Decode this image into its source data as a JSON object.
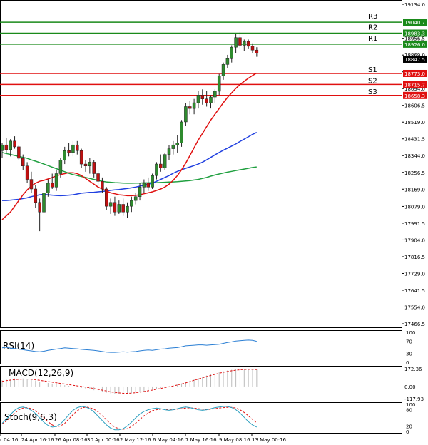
{
  "chart_data": {
    "type": "candlestick",
    "main": {
      "price_ticks": [
        "19134.0",
        "19046.5",
        "18956.5",
        "18869.0",
        "18781.5",
        "18694.0",
        "18606.5",
        "18519.0",
        "18431.5",
        "18344.0",
        "18256.5",
        "18169.0",
        "18079.0",
        "17991.5",
        "17904.0",
        "17816.5",
        "17729.0",
        "17641.5",
        "17554.0",
        "17466.5"
      ],
      "ylim": [
        17466.5,
        19134.0
      ],
      "current_price": "18847.5",
      "levels": [
        {
          "name": "R3",
          "value": 19040.7,
          "label": "19040.7",
          "color": "#1a8a1a"
        },
        {
          "name": "R2",
          "value": 18983.3,
          "label": "18983.3",
          "color": "#1a8a1a"
        },
        {
          "name": "R1",
          "value": 18926.0,
          "label": "18926.0",
          "color": "#1a8a1a"
        },
        {
          "name": "S1",
          "value": 18773.0,
          "label": "18773.0",
          "color": "#e01010"
        },
        {
          "name": "S2",
          "value": 18715.7,
          "label": "18715.7",
          "color": "#e01010"
        },
        {
          "name": "S3",
          "value": 18658.3,
          "label": "18658.3",
          "color": "#e01010"
        }
      ],
      "candles": [
        [
          18370,
          18410,
          18330,
          18400
        ],
        [
          18400,
          18435,
          18360,
          18375
        ],
        [
          18375,
          18430,
          18340,
          18420
        ],
        [
          18420,
          18445,
          18380,
          18390
        ],
        [
          18390,
          18400,
          18320,
          18330
        ],
        [
          18330,
          18350,
          18270,
          18290
        ],
        [
          18290,
          18310,
          18200,
          18220
        ],
        [
          18220,
          18260,
          18150,
          18170
        ],
        [
          18170,
          18190,
          18070,
          18100
        ],
        [
          18100,
          18120,
          17950,
          18050
        ],
        [
          18050,
          18170,
          18040,
          18150
        ],
        [
          18150,
          18220,
          18130,
          18200
        ],
        [
          18200,
          18250,
          18170,
          18180
        ],
        [
          18180,
          18270,
          18160,
          18250
        ],
        [
          18250,
          18330,
          18230,
          18320
        ],
        [
          18320,
          18390,
          18300,
          18370
        ],
        [
          18370,
          18410,
          18340,
          18360
        ],
        [
          18360,
          18420,
          18340,
          18400
        ],
        [
          18400,
          18420,
          18350,
          18370
        ],
        [
          18370,
          18380,
          18280,
          18300
        ],
        [
          18300,
          18320,
          18260,
          18290
        ],
        [
          18290,
          18330,
          18250,
          18310
        ],
        [
          18310,
          18320,
          18230,
          18250
        ],
        [
          18250,
          18270,
          18190,
          18210
        ],
        [
          18210,
          18230,
          18150,
          18170
        ],
        [
          18170,
          18180,
          18060,
          18080
        ],
        [
          18080,
          18120,
          18040,
          18100
        ],
        [
          18100,
          18130,
          18030,
          18050
        ],
        [
          18050,
          18110,
          18040,
          18090
        ],
        [
          18090,
          18120,
          18030,
          18050
        ],
        [
          18050,
          18100,
          18020,
          18080
        ],
        [
          18080,
          18130,
          18050,
          18110
        ],
        [
          18110,
          18150,
          18090,
          18130
        ],
        [
          18130,
          18200,
          18110,
          18180
        ],
        [
          18180,
          18220,
          18150,
          18200
        ],
        [
          18200,
          18230,
          18160,
          18180
        ],
        [
          18180,
          18250,
          18170,
          18240
        ],
        [
          18240,
          18310,
          18220,
          18300
        ],
        [
          18300,
          18350,
          18260,
          18280
        ],
        [
          18280,
          18360,
          18270,
          18350
        ],
        [
          18350,
          18400,
          18320,
          18380
        ],
        [
          18380,
          18420,
          18350,
          18400
        ],
        [
          18400,
          18450,
          18360,
          18410
        ],
        [
          18410,
          18530,
          18390,
          18520
        ],
        [
          18520,
          18620,
          18500,
          18600
        ],
        [
          18600,
          18630,
          18560,
          18590
        ],
        [
          18590,
          18640,
          18560,
          18620
        ],
        [
          18620,
          18680,
          18590,
          18660
        ],
        [
          18660,
          18690,
          18610,
          18640
        ],
        [
          18640,
          18680,
          18600,
          18620
        ],
        [
          18620,
          18660,
          18590,
          18650
        ],
        [
          18650,
          18690,
          18620,
          18680
        ],
        [
          18680,
          18770,
          18660,
          18760
        ],
        [
          18760,
          18830,
          18740,
          18820
        ],
        [
          18820,
          18870,
          18800,
          18850
        ],
        [
          18850,
          18920,
          18830,
          18910
        ],
        [
          18910,
          18980,
          18880,
          18960
        ],
        [
          18960,
          18990,
          18900,
          18920
        ],
        [
          18920,
          18950,
          18890,
          18940
        ],
        [
          18940,
          18950,
          18900,
          18915
        ],
        [
          18915,
          18930,
          18880,
          18895
        ],
        [
          18895,
          18910,
          18860,
          18880
        ]
      ],
      "ma_fast": [
        18010,
        18030,
        18050,
        18080,
        18110,
        18140,
        18165,
        18185,
        18200,
        18210,
        18215,
        18222,
        18230,
        18238,
        18245,
        18250,
        18255,
        18255,
        18250,
        18240,
        18225,
        18210,
        18195,
        18180,
        18170,
        18160,
        18150,
        18145,
        18140,
        18138,
        18135,
        18135,
        18137,
        18140,
        18145,
        18150,
        18155,
        18162,
        18170,
        18180,
        18195,
        18215,
        18240,
        18270,
        18305,
        18345,
        18385,
        18425,
        18460,
        18495,
        18530,
        18560,
        18590,
        18620,
        18648,
        18672,
        18695,
        18715,
        18732,
        18748,
        18762,
        18775
      ],
      "ma_mid": [
        18110,
        18110,
        18112,
        18114,
        18116,
        18120,
        18124,
        18130,
        18135,
        18140,
        18142,
        18140,
        18138,
        18136,
        18135,
        18136,
        18138,
        18140,
        18144,
        18148,
        18150,
        18152,
        18153,
        18155,
        18157,
        18160,
        18163,
        18165,
        18167,
        18170,
        18173,
        18176,
        18180,
        18185,
        18190,
        18195,
        18200,
        18210,
        18220,
        18230,
        18240,
        18252,
        18262,
        18270,
        18278,
        18285,
        18292,
        18300,
        18310,
        18322,
        18335,
        18348,
        18360,
        18372,
        18383,
        18394,
        18405,
        18418,
        18430,
        18442,
        18455,
        18465
      ],
      "ma_slow": [
        18360,
        18355,
        18350,
        18345,
        18340,
        18335,
        18330,
        18322,
        18315,
        18308,
        18300,
        18292,
        18284,
        18276,
        18268,
        18260,
        18252,
        18245,
        18240,
        18235,
        18230,
        18225,
        18220,
        18215,
        18210,
        18207,
        18205,
        18203,
        18202,
        18201,
        18200,
        18200,
        18201,
        18201,
        18202,
        18202,
        18203,
        18203,
        18204,
        18205,
        18206,
        18207,
        18208,
        18210,
        18212,
        18214,
        18217,
        18220,
        18225,
        18230,
        18237,
        18243,
        18248,
        18253,
        18258,
        18262,
        18266,
        18270,
        18274,
        18278,
        18282,
        18285
      ],
      "colors": {
        "ma_fast": "#e01010",
        "ma_mid": "#2040e0",
        "ma_slow": "#20a040",
        "bull": "#2e8b2e",
        "bear": "#c01010",
        "grid": "#dddddd"
      }
    },
    "rsi": {
      "label": "RSI(14)",
      "ticks": [
        "100",
        "70",
        "30",
        "0"
      ],
      "ylim": [
        0,
        100
      ],
      "values": [
        48,
        50,
        47,
        46,
        44,
        42,
        40,
        38,
        36,
        35,
        37,
        40,
        42,
        44,
        46,
        48,
        47,
        46,
        45,
        43,
        42,
        41,
        40,
        38,
        36,
        34,
        33,
        33,
        34,
        35,
        34,
        35,
        36,
        38,
        40,
        41,
        40,
        42,
        44,
        45,
        47,
        48,
        49,
        52,
        55,
        56,
        57,
        58,
        58,
        57,
        58,
        59,
        60,
        63,
        66,
        68,
        71,
        72,
        73,
        74,
        73,
        70
      ],
      "color": "#2b7fd4"
    },
    "macd": {
      "label": "MACD(12,26,9)",
      "ticks": [
        "172.36",
        "0.00",
        "-117.93"
      ],
      "ylim": [
        -117.93,
        172.36
      ],
      "histogram": [
        60,
        68,
        74,
        78,
        80,
        78,
        72,
        66,
        58,
        48,
        40,
        34,
        28,
        22,
        18,
        12,
        6,
        0,
        -6,
        -14,
        -20,
        -28,
        -36,
        -44,
        -52,
        -60,
        -66,
        -70,
        -72,
        -72,
        -70,
        -66,
        -60,
        -54,
        -46,
        -38,
        -30,
        -22,
        -14,
        -6,
        2,
        10,
        20,
        30,
        42,
        56,
        70,
        82,
        94,
        106,
        118,
        128,
        138,
        148,
        156,
        162,
        168,
        170,
        172,
        171,
        168,
        164
      ],
      "signal": [
        50,
        56,
        62,
        66,
        70,
        72,
        72,
        70,
        66,
        60,
        54,
        48,
        42,
        36,
        30,
        24,
        18,
        12,
        6,
        0,
        -6,
        -12,
        -20,
        -28,
        -36,
        -44,
        -52,
        -58,
        -62,
        -66,
        -66,
        -64,
        -60,
        -55,
        -49,
        -42,
        -35,
        -27,
        -19,
        -11,
        -3,
        5,
        14,
        24,
        35,
        47,
        60,
        72,
        84,
        96,
        107,
        118,
        128,
        138,
        146,
        152,
        158,
        162,
        165,
        166,
        166,
        164
      ],
      "hist_color": "#bbbbbb",
      "signal_color": "#e01010"
    },
    "stoch": {
      "label": "Stoch(9,6,3)",
      "ticks": [
        "100",
        "80",
        "20",
        "0"
      ],
      "ylim": [
        0,
        100
      ],
      "k": [
        30,
        45,
        62,
        78,
        88,
        90,
        86,
        78,
        66,
        50,
        34,
        22,
        16,
        18,
        28,
        44,
        62,
        78,
        88,
        92,
        90,
        84,
        72,
        56,
        40,
        24,
        12,
        6,
        6,
        10,
        20,
        34,
        50,
        64,
        74,
        80,
        84,
        86,
        84,
        80,
        78,
        80,
        84,
        88,
        90,
        88,
        84,
        80,
        78,
        80,
        84,
        88,
        90,
        92,
        92,
        88,
        80,
        68,
        52,
        36,
        24,
        16
      ],
      "d": [
        28,
        38,
        52,
        66,
        80,
        86,
        88,
        84,
        76,
        64,
        50,
        36,
        24,
        18,
        20,
        30,
        46,
        62,
        76,
        86,
        90,
        88,
        82,
        72,
        58,
        42,
        28,
        16,
        10,
        8,
        10,
        18,
        30,
        44,
        58,
        68,
        76,
        80,
        82,
        82,
        80,
        80,
        82,
        84,
        86,
        87,
        86,
        84,
        82,
        80,
        82,
        84,
        86,
        88,
        89,
        89,
        86,
        80,
        70,
        58,
        44,
        32
      ],
      "k_color": "#2b9fbf",
      "d_color": "#e01010"
    },
    "x_labels": [
      "r 04:16",
      "24 Apr 16:16",
      "26 Apr 08:16",
      "30 Apr 00:16",
      "2 May 12:16",
      "6 May 04:16",
      "7 May 16:16",
      "9 May 08:16",
      "13 May 00:16"
    ]
  }
}
